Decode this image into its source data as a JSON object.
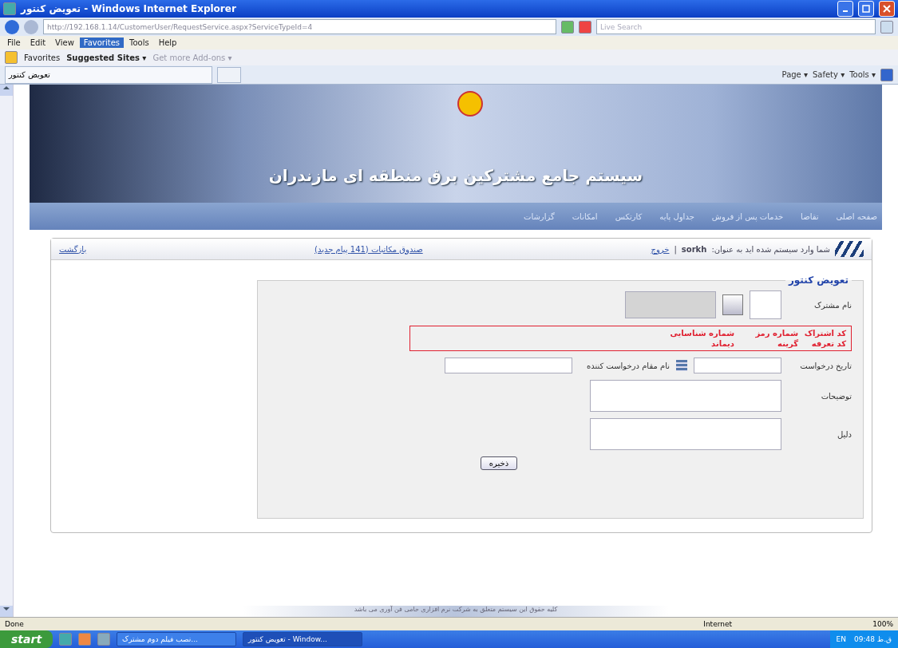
{
  "window": {
    "title": "تعویض کنتور - Windows Internet Explorer"
  },
  "address_bar": {
    "url": "http://192.168.1.14/CustomerUser/RequestService.aspx?ServiceTypeId=4",
    "search_placeholder": "Live Search"
  },
  "menu": {
    "file": {
      "label": "File",
      "selected": false
    },
    "edit": {
      "label": "Edit",
      "selected": false
    },
    "view": {
      "label": "View",
      "selected": false
    },
    "favorites": {
      "label": "Favorites",
      "selected": true
    },
    "tools": {
      "label": "Tools",
      "selected": false
    },
    "help": {
      "label": "Help",
      "selected": false
    }
  },
  "favorites_bar": {
    "favorites": "Favorites",
    "suggested_sites": "Suggested Sites ▾",
    "add_ons": "Get more Add-ons ▾"
  },
  "tab": {
    "title": "تعویض کنتور"
  },
  "command_bar": {
    "page": "Page ▾",
    "safety": "Safety ▾",
    "tools": "Tools ▾"
  },
  "banner": {
    "title": "سیستم جامع مشترکین برق منطقه ای مازندران"
  },
  "nav": [
    "صفحه اصلی",
    "تقاضا",
    "خدمات پس از فروش",
    "جداول پایه",
    "کارتکس",
    "امکانات",
    "گزارشات"
  ],
  "info_bar": {
    "logged_in": "شما وارد سیستم شده اید به عنوان:",
    "user": "sorkh",
    "separator": "|",
    "logout": "خروج",
    "inbox": "صندوق مکاتبات (141 پیام جدید)",
    "back": "بازگشت"
  },
  "form": {
    "title": "تعویض کنتور",
    "subscriber_label": "نام مشترک",
    "info_rows": [
      [
        "کد اشتراک",
        "شماره رمز",
        "شماره شناسایی"
      ],
      [
        "کد تعرفه",
        "گرینه",
        "دیماند"
      ]
    ],
    "date_label": "تاریخ درخواست",
    "requester_label": "نام مقام درخواست کننده",
    "notes_label": "توضیحات",
    "reason_label": "دلیل",
    "save": "ذخیره"
  },
  "footer": "کلیه حقوق این سیستم متعلق به شرکت نرم افزاری حامی فن آوری می باشد",
  "status_bar": {
    "status": "Done",
    "zone": "Internet",
    "zoom": "100%"
  },
  "taskbar": {
    "start": "start",
    "other_window": {
      "label": "نصب فیلم دوم مشترک...",
      "selected": false
    },
    "browser_window": {
      "label": "تعویض کنتور - Window...",
      "selected": true
    },
    "lang": "EN",
    "clock": "09:48 ق.ظ"
  }
}
